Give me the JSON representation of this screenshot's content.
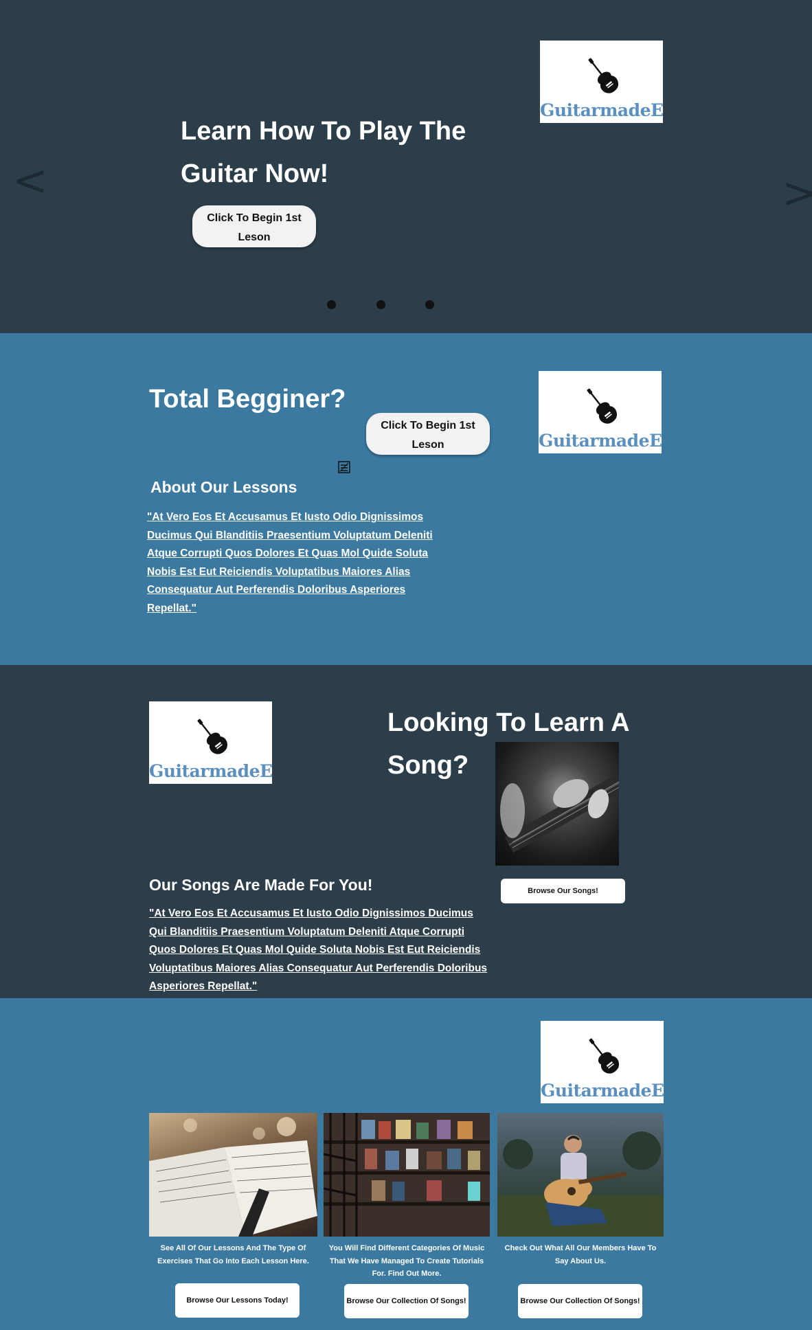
{
  "brand": {
    "logo_text": "GuitarmadeEZ"
  },
  "hero": {
    "title": "Learn How To Play The Guitar Now!",
    "cta_label": "Click To Begin 1st Leson",
    "prev_arrow": "<",
    "next_arrow": ">",
    "slide_dots": 3
  },
  "beginner": {
    "title": "Total Begginer?",
    "cta_label": "Click To Begin 1st Leson",
    "about_heading": "About Our Lessons",
    "about_text": "\"At Vero Eos Et Accusamus Et Iusto Odio Dignissimos Ducimus Qui Blanditiis Praesentium Voluptatum Deleniti Atque Corrupti Quos Dolores Et Quas Mol Quide Soluta Nobis Est Eut Reiciendis Voluptatibus Maiores Alias Consequatur Aut Perferendis Doloribus Asperiores Repellat.\""
  },
  "songs": {
    "title": "Looking To Learn A Song?",
    "subheading": "Our Songs Are Made For You!",
    "text": "\"At Vero Eos Et Accusamus Et Iusto Odio Dignissimos Ducimus Qui Blanditiis Praesentium Voluptatum Deleniti Atque Corrupti Quos Dolores Et Quas Mol Quide Soluta Nobis Est Eut Reiciendis Voluptatibus Maiores Alias Consequatur Aut Perferendis Doloribus Asperiores Repellat.\"",
    "button_label": "Browse Our Songs!"
  },
  "browse": {
    "cards": [
      {
        "caption": "See All Of Our Lessons And The Type Of Exercises That Go Into Each Lesson Here.",
        "button": "Browse Our Lessons Today!"
      },
      {
        "caption": "You Will Find Different Categories Of Music That We Have Managed To Create Tutorials For. Find Out More.",
        "button": "Browse Our Collection Of Songs!"
      },
      {
        "caption": "Check Out What All Our Members Have To Say About Us.",
        "button": "Browse Our Collection Of Songs!"
      }
    ]
  },
  "colors": {
    "dark": "#2c3e4a",
    "blue": "#3b79a0",
    "logo_text": "#5b8fbf"
  }
}
